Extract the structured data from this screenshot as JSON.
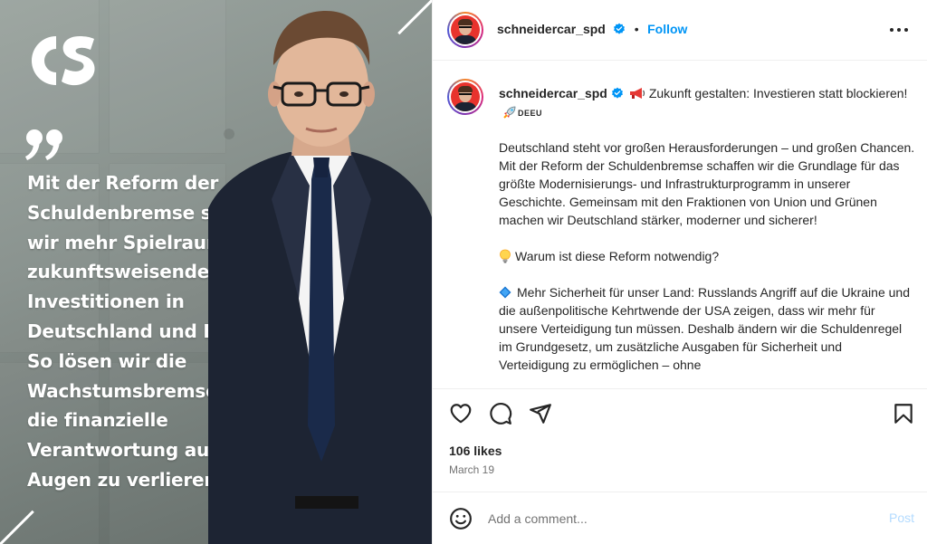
{
  "media": {
    "quote": "Mit der Reform der\nSchuldenbremse schaffen\nwir mehr Spielraum für\nzukunftsweisende\nInvestitionen in\nDeutschland und Europa.\nSo lösen wir die\nWachstumsbremse, ohne\ndie finanzielle\nVerantwortung aus den\nAugen zu verlieren.",
    "logo_icon": "cs-logo",
    "quote_icon": "quotation-mark-icon"
  },
  "header": {
    "username": "schneidercar_spd",
    "separator": "•",
    "follow_label": "Follow",
    "more_icon": "more-options-icon"
  },
  "caption": {
    "username": "schneidercar_spd",
    "headline": "Zukunft gestalten: Investieren statt blockieren!",
    "flag_text": "DEEU",
    "paragraphs": [
      "Deutschland steht vor großen Herausforderungen – und großen Chancen. Mit der Reform der Schuldenbremse schaffen wir die Grundlage für das größte Modernisierungs- und Infrastrukturprogramm in unserer Geschichte. Gemeinsam mit den Fraktionen von Union und Grünen machen wir Deutschland stärker, moderner und sicherer!",
      "Warum ist diese Reform notwendig?",
      "Mehr Sicherheit für unser Land: Russlands Angriff auf die Ukraine und die außenpolitische Kehrtwende der USA zeigen, dass wir mehr für unsere Verteidigung tun müssen. Deshalb ändern wir die Schuldenregel im Grundgesetz, um zusätzliche Ausgaben für Sicherheit und Verteidigung zu ermöglichen – ohne"
    ]
  },
  "actions": {
    "likes": "106 likes",
    "date": "March 19"
  },
  "comment": {
    "placeholder": "Add a comment...",
    "post_label": "Post"
  },
  "colors": {
    "accent": "#0095f6",
    "verified": "#0095f6",
    "muted": "#737373",
    "post_disabled": "#b3dbff",
    "avatar_bg": "#e8332d"
  }
}
